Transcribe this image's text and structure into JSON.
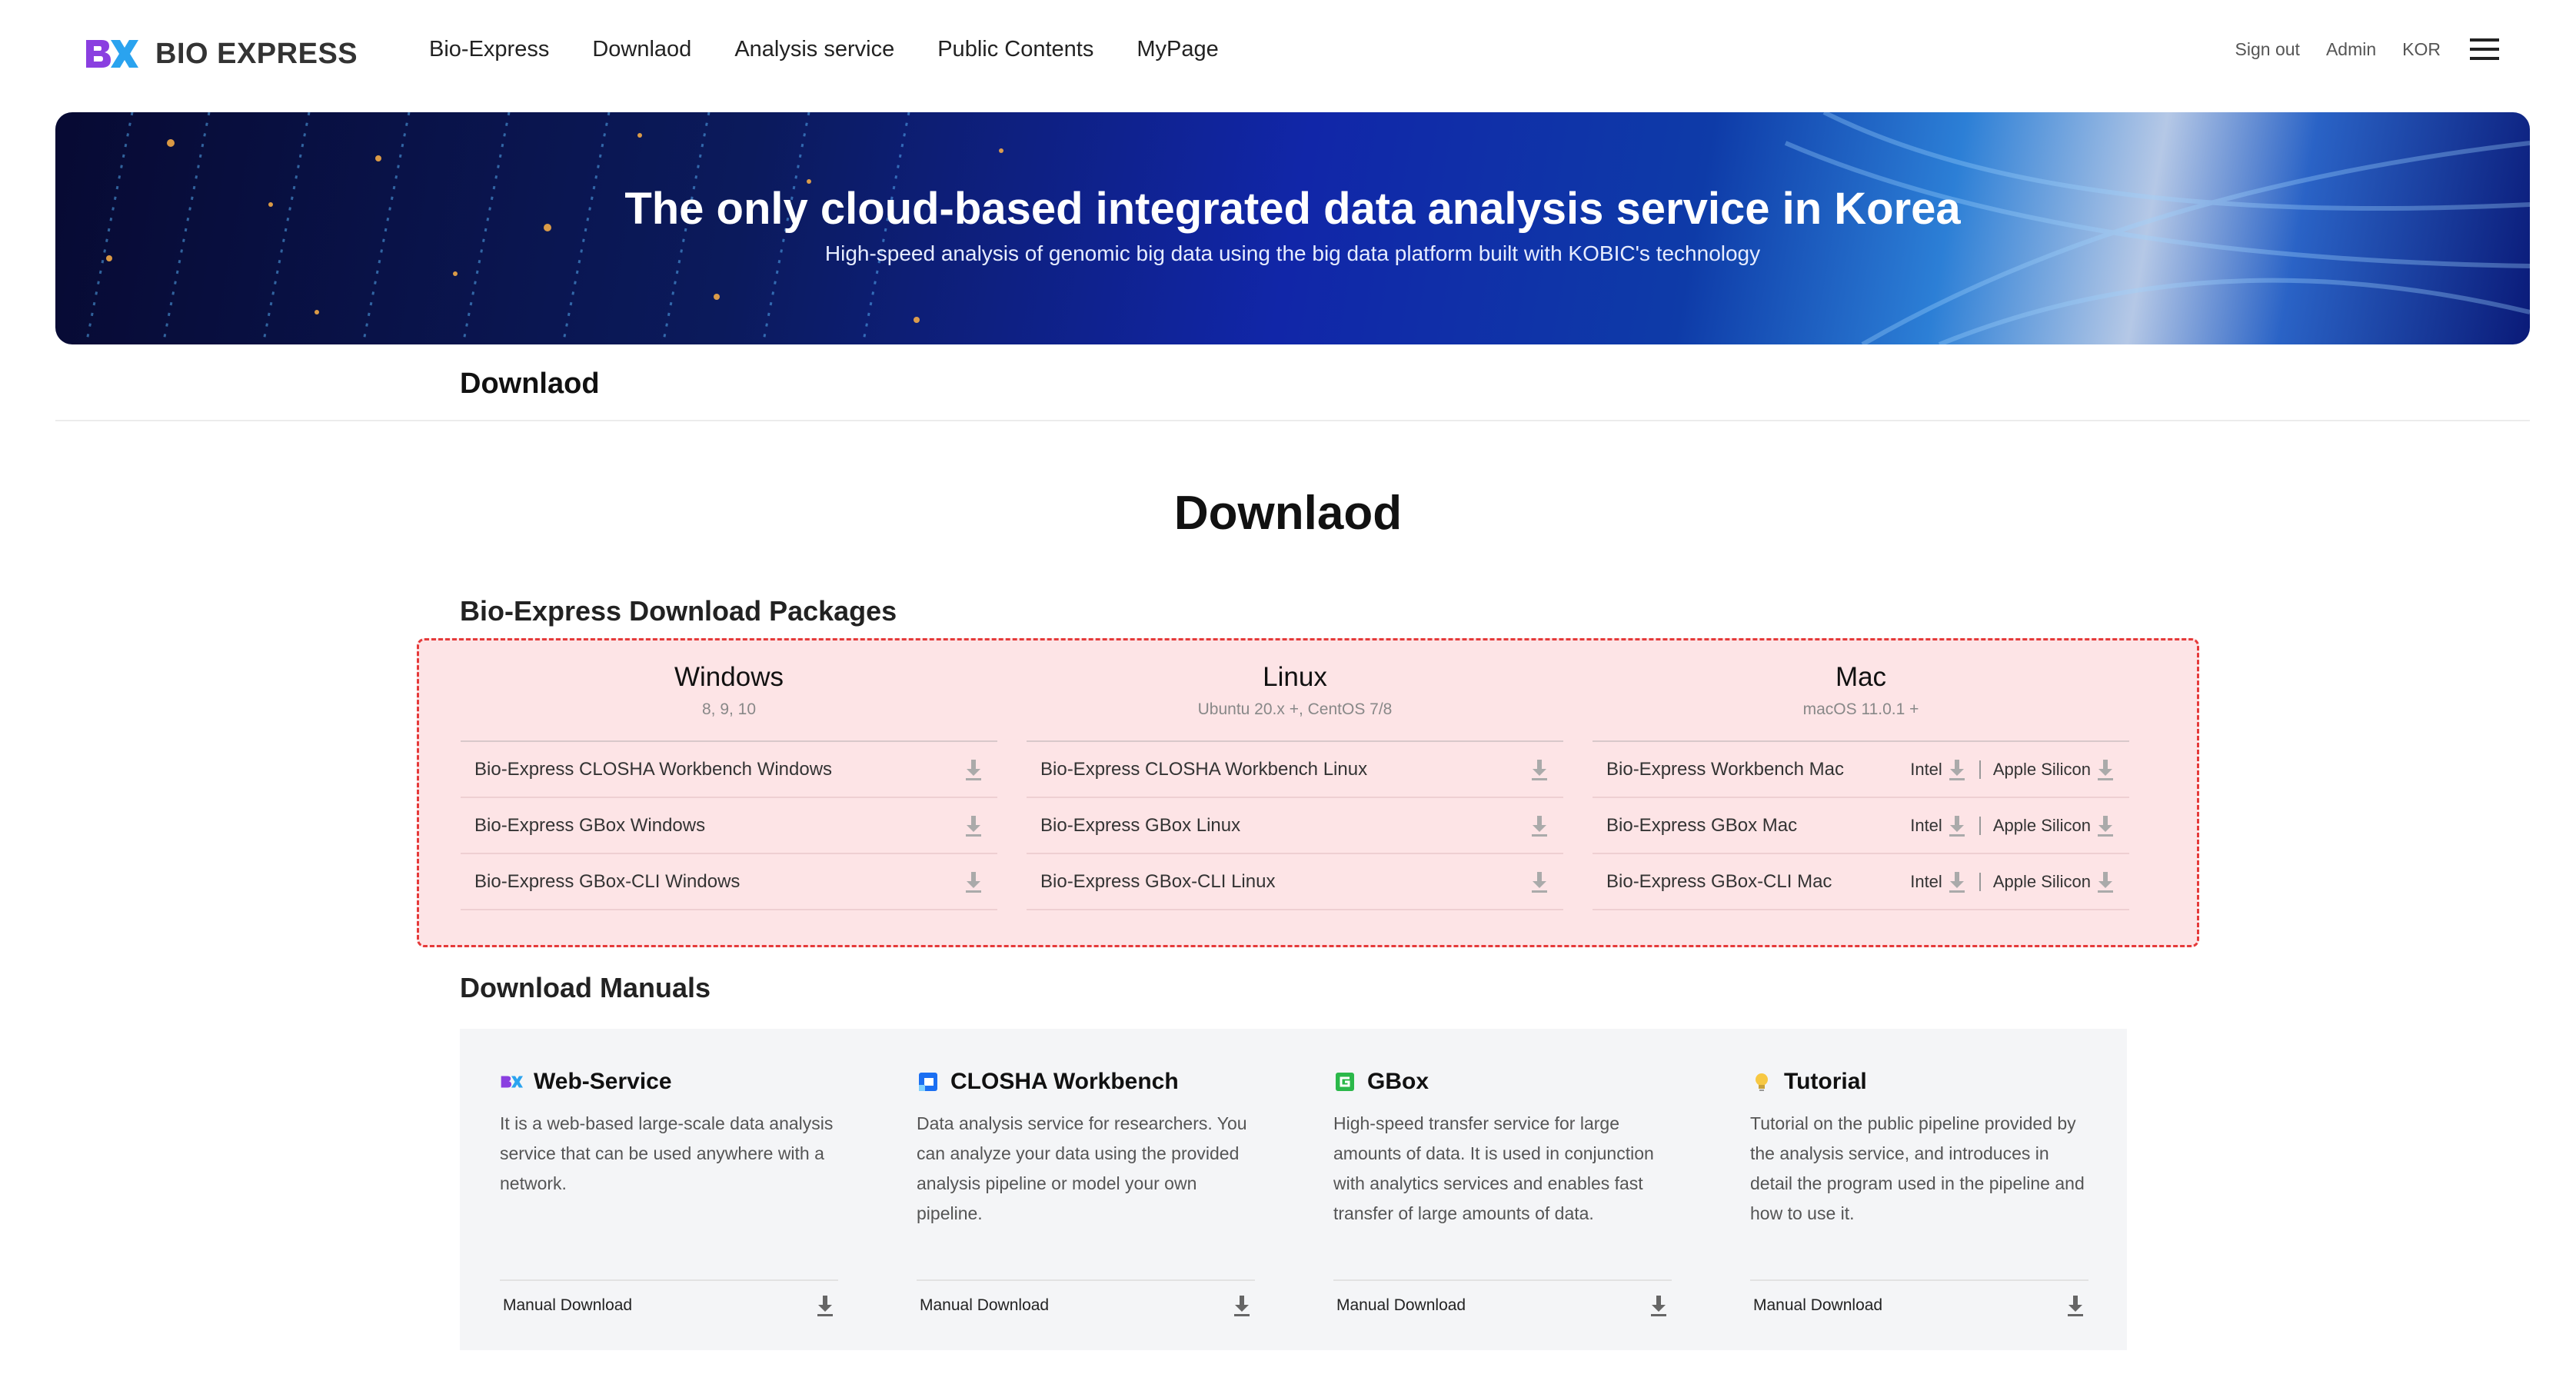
{
  "header": {
    "logo_text": "BIO EXPRESS",
    "nav": [
      "Bio-Express",
      "Downlaod",
      "Analysis service",
      "Public Contents",
      "MyPage"
    ],
    "utility": {
      "sign_out": "Sign out",
      "admin": "Admin",
      "language": "KOR"
    }
  },
  "hero": {
    "title": "The only cloud-based integrated data analysis service in Korea",
    "subtitle": "High-speed analysis of genomic big data using the big data platform built with KOBIC's technology"
  },
  "page_title": "Downlaod",
  "main_title": "Downlaod",
  "packages": {
    "section_title": "Bio-Express Download Packages",
    "columns": [
      {
        "os": "Windows",
        "versions": "8, 9, 10",
        "items": [
          "Bio-Express CLOSHA Workbench Windows",
          "Bio-Express GBox Windows",
          "Bio-Express GBox-CLI Windows"
        ]
      },
      {
        "os": "Linux",
        "versions": "Ubuntu 20.x +, CentOS 7/8",
        "items": [
          "Bio-Express CLOSHA Workbench Linux",
          "Bio-Express GBox Linux",
          "Bio-Express GBox-CLI Linux"
        ]
      },
      {
        "os": "Mac",
        "versions": "macOS 11.0.1 +",
        "items": [
          "Bio-Express Workbench Mac",
          "Bio-Express GBox Mac",
          "Bio-Express GBox-CLI Mac"
        ],
        "variants": [
          "Intel",
          "Apple Silicon"
        ]
      }
    ]
  },
  "manuals": {
    "section_title": "Download Manuals",
    "cards": [
      {
        "title": "Web-Service",
        "icon": "bx-logo-icon",
        "description": "It is a web-based large-scale data analysis service that can be used anywhere with a network.",
        "download_label": "Manual Download"
      },
      {
        "title": "CLOSHA Workbench",
        "icon": "closha-icon",
        "description": "Data analysis service for researchers. You can analyze your data using the provided analysis pipeline or model your own pipeline.",
        "download_label": "Manual Download"
      },
      {
        "title": "GBox",
        "icon": "gbox-icon",
        "description": "High-speed transfer service for large amounts of data. It is used in conjunction with analytics services and enables fast transfer of large amounts of data.",
        "download_label": "Manual Download"
      },
      {
        "title": "Tutorial",
        "icon": "lightbulb-icon",
        "description": "Tutorial on the public pipeline provided by the analysis service, and introduces in detail the program used in the pipeline and how to use it.",
        "download_label": "Manual Download"
      }
    ]
  },
  "colors": {
    "highlight_fill": "#fde4e6",
    "highlight_border": "#e53a3a",
    "brand_purple": "#7b3fe4",
    "brand_blue": "#2b6ff0"
  }
}
